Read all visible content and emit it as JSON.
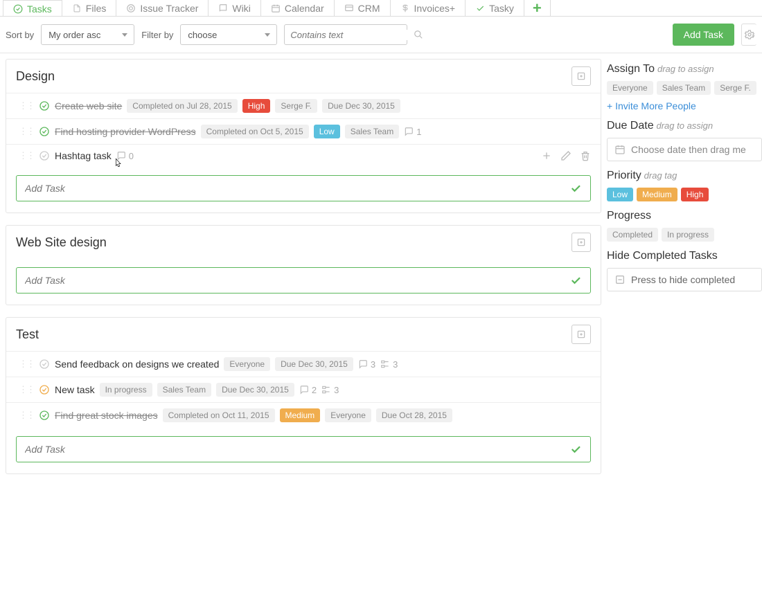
{
  "tabs": [
    {
      "label": "Tasks",
      "icon": "check"
    },
    {
      "label": "Files",
      "icon": "file"
    },
    {
      "label": "Issue Tracker",
      "icon": "target"
    },
    {
      "label": "Wiki",
      "icon": "book"
    },
    {
      "label": "Calendar",
      "icon": "cal"
    },
    {
      "label": "CRM",
      "icon": "crm"
    },
    {
      "label": "Invoices+",
      "icon": "dollar"
    },
    {
      "label": "Tasky",
      "icon": "checkgreen"
    }
  ],
  "toolbar": {
    "sort_label": "Sort by",
    "sort_value": "My order asc",
    "filter_label": "Filter by",
    "filter_value": "choose",
    "search_placeholder": "Contains text",
    "add_task_btn": "Add Task"
  },
  "sections": [
    {
      "title": "Design",
      "tasks": [
        {
          "name": "Create web site",
          "done": true,
          "status": "Completed on Jul 28, 2015",
          "priority": "High",
          "assignee": "Serge F.",
          "due": "Due Dec 30, 2015"
        },
        {
          "name": "Find hosting provider WordPress",
          "done": true,
          "status": "Completed on Oct 5, 2015",
          "priority": "Low",
          "assignee": "Sales Team",
          "comments": "1"
        },
        {
          "name": "Hashtag task",
          "done": false,
          "comments": "0",
          "hovered": true
        }
      ],
      "cursor": true
    },
    {
      "title": "Web Site design",
      "tasks": []
    },
    {
      "title": "Test",
      "tasks": [
        {
          "name": "Send feedback on designs we created",
          "done": false,
          "assignee": "Everyone",
          "due": "Due Dec 30, 2015",
          "comments": "3",
          "subtasks": "3"
        },
        {
          "name": "New task",
          "done": false,
          "progress_chip": "In progress",
          "assignee": "Sales Team",
          "due": "Due Dec 30, 2015",
          "comments": "2",
          "subtasks": "3",
          "status_color": "orange"
        },
        {
          "name": "Find great stock images",
          "done": true,
          "status": "Completed on Oct 11, 2015",
          "priority": "Medium",
          "assignee": "Everyone",
          "due": "Due Oct 28, 2015"
        }
      ]
    }
  ],
  "add_task_placeholder": "Add Task",
  "sidebar": {
    "assign_title": "Assign To",
    "assign_hint": "drag to assign",
    "assign_chips": [
      "Everyone",
      "Sales Team",
      "Serge F."
    ],
    "invite_link": "+ Invite More People",
    "due_title": "Due Date",
    "due_hint": "drag to assign",
    "due_placeholder": "Choose date then drag me",
    "priority_title": "Priority",
    "priority_hint": "drag tag",
    "priority_chips": [
      {
        "label": "Low",
        "cls": "blue"
      },
      {
        "label": "Medium",
        "cls": "orange"
      },
      {
        "label": "High",
        "cls": "red"
      }
    ],
    "progress_title": "Progress",
    "progress_chips": [
      "Completed",
      "In progress"
    ],
    "hide_title": "Hide Completed Tasks",
    "hide_btn": "Press to hide completed"
  }
}
